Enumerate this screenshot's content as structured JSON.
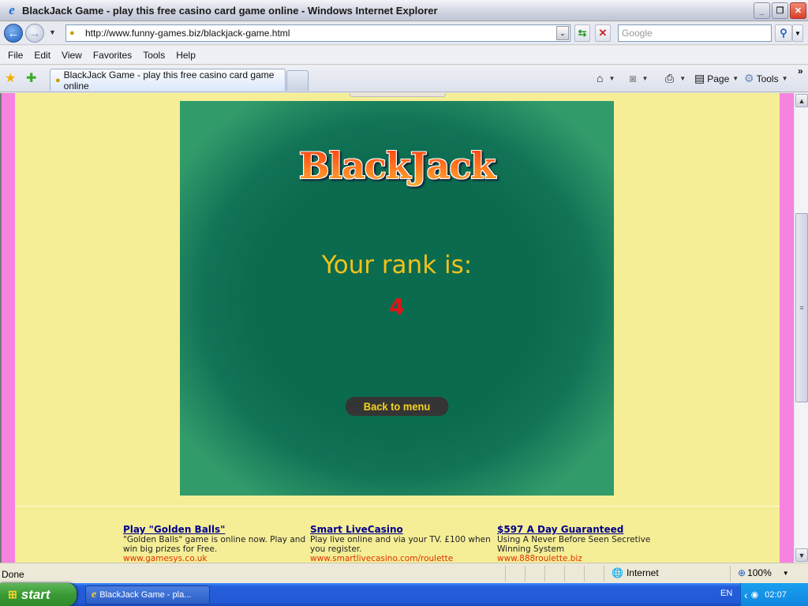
{
  "window": {
    "title": "BlackJack Game - play this free casino card game online - Windows Internet Explorer",
    "buttons": [
      "minimize",
      "restore",
      "close"
    ]
  },
  "address_bar": {
    "url": "http://www.funny-games.biz/blackjack-game.html",
    "search_placeholder": "Google"
  },
  "menu": {
    "items": [
      "File",
      "Edit",
      "View",
      "Favorites",
      "Tools",
      "Help"
    ]
  },
  "tabs": {
    "active_tab_title": "BlackJack Game - play this free casino card game online"
  },
  "command_bar": {
    "page_label": "Page",
    "tools_label": "Tools",
    "overflow": "»"
  },
  "game": {
    "logo": "BlackJack",
    "rank_label": "Your rank is:",
    "rank_value": "4",
    "back_button": "Back to menu"
  },
  "ads": [
    {
      "title": "Play \"Golden Balls\"",
      "text": "\"Golden Balls\" game is online now. Play and win big prizes for Free.",
      "url": "www.gamesys.co.uk"
    },
    {
      "title": "Smart LiveCasino",
      "text": "Play live online and via your TV. £100 when you register.",
      "url": "www.smartlivecasino.com/roulette"
    },
    {
      "title": "$597 A Day Guaranteed",
      "text": "Using A Never Before Seen Secretive Winning System",
      "url": "www.888roulette.biz"
    }
  ],
  "status_bar": {
    "status": "Done",
    "zone": "Internet",
    "zoom": "100%"
  },
  "taskbar": {
    "start_label": "start",
    "task_label": "BlackJack Game - pla...",
    "language": "EN",
    "clock": "02:07"
  },
  "colors": {
    "page_bg": "#f5ee96",
    "side_strip": "#f683e0",
    "table_green": "#0b6b4f",
    "rank_label": "#f2c21a",
    "rank_value": "#e01616",
    "ad_title": "#00008b",
    "ad_url": "#e03000"
  }
}
